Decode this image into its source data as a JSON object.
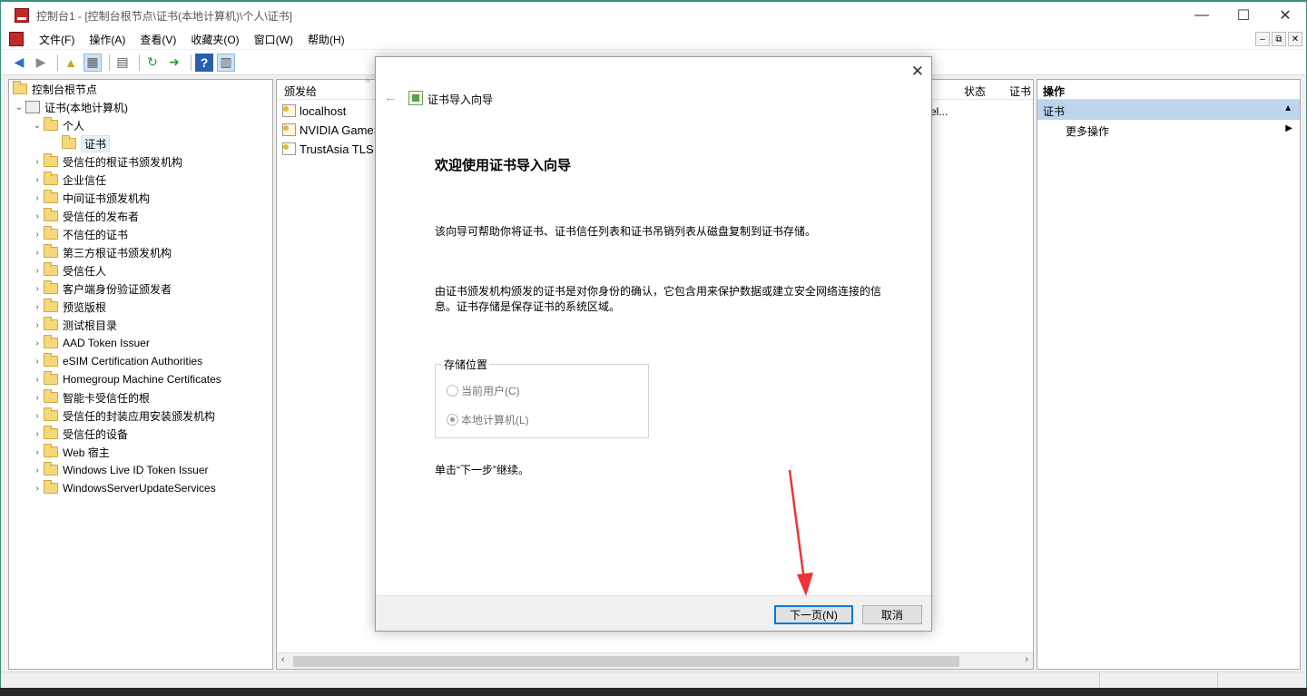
{
  "window": {
    "title": "控制台1 - [控制台根节点\\证书(本地计算机)\\个人\\证书]",
    "minimize": "—",
    "maximize": "☐",
    "close": "✕"
  },
  "menu": [
    "文件(F)",
    "操作(A)",
    "查看(V)",
    "收藏夹(O)",
    "窗口(W)",
    "帮助(H)"
  ],
  "mdi_controls": [
    "‒",
    "⧉",
    "✕"
  ],
  "tree": {
    "root": "控制台根节点",
    "computer": "证书(本地计算机)",
    "personal": "个人",
    "certificates": "证书",
    "stores": [
      "受信任的根证书颁发机构",
      "企业信任",
      "中间证书颁发机构",
      "受信任的发布者",
      "不信任的证书",
      "第三方根证书颁发机构",
      "受信任人",
      "客户端身份验证颁发者",
      "预览版根",
      "测试根目录",
      "AAD Token Issuer",
      "eSIM Certification Authorities",
      "Homegroup Machine Certificates",
      "智能卡受信任的根",
      "受信任的封装应用安装颁发机构",
      "受信任的设备",
      "Web 宿主",
      "Windows Live ID Token Issuer",
      "WindowsServerUpdateServices"
    ]
  },
  "list": {
    "col_issued_to": "颁发给",
    "col_status": "状态",
    "col_cert": "证书",
    "truncated_text": "el...",
    "rows": [
      "localhost",
      "NVIDIA GameS",
      "TrustAsia TLS R"
    ]
  },
  "actions": {
    "title": "操作",
    "section": "证书",
    "more": "更多操作"
  },
  "dialog": {
    "close": "✕",
    "back": "←",
    "title": "证书导入向导",
    "heading": "欢迎使用证书导入向导",
    "p1": "该向导可帮助你将证书、证书信任列表和证书吊销列表从磁盘复制到证书存储。",
    "p2": "由证书颁发机构颁发的证书是对你身份的确认，它包含用来保护数据或建立安全网络连接的信息。证书存储是保存证书的系统区域。",
    "group_label": "存储位置",
    "radio_current_user": "当前用户(C)",
    "radio_local_machine": "本地计算机(L)",
    "continue_hint": "单击“下一步”继续。",
    "next_button": "下一页(N)",
    "cancel_button": "取消"
  },
  "colors": {
    "accent_border": "#3a8f7f",
    "selection": "#bcd4ec",
    "primary_button_border": "#0078d7",
    "annotation_arrow": "#ee3333"
  }
}
